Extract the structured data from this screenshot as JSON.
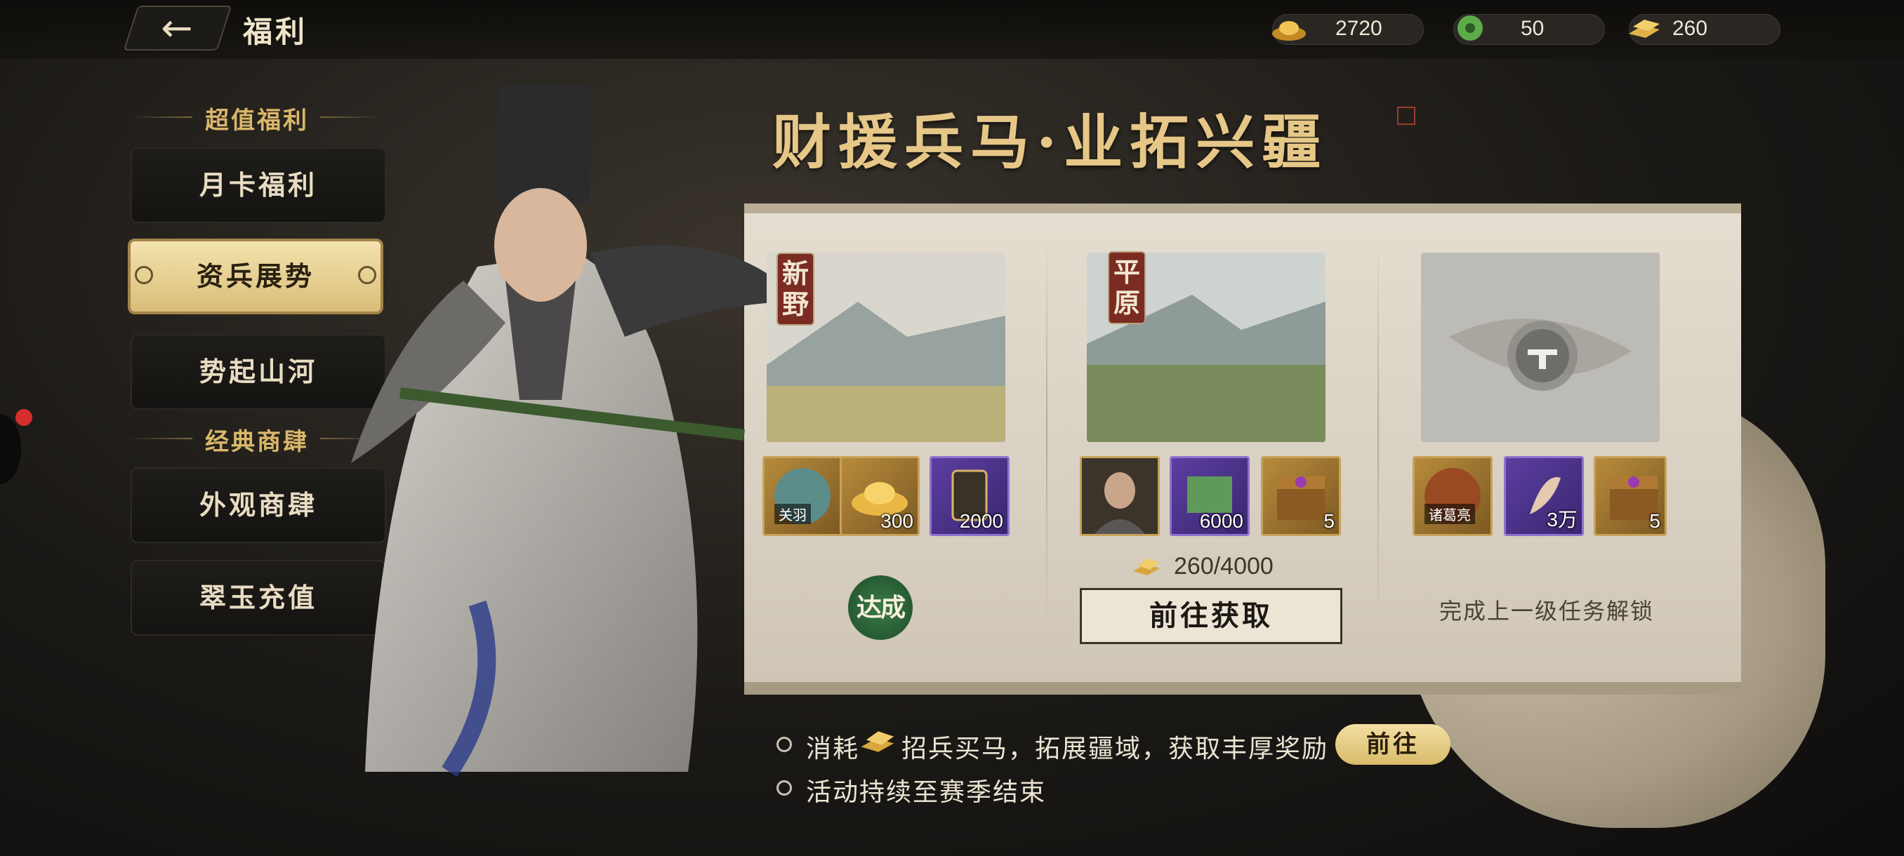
{
  "header": {
    "back_icon": "arrow-left-icon",
    "title": "福利",
    "currencies": [
      {
        "icon": "gold-ingot-icon",
        "value": "2720"
      },
      {
        "icon": "jade-coin-icon",
        "value": "50"
      },
      {
        "icon": "gold-bars-icon",
        "value": "260"
      }
    ]
  },
  "sidebar": {
    "section1_title": "超值福利",
    "section2_title": "经典商肆",
    "items": [
      {
        "label": "月卡福利"
      },
      {
        "label": "资兵展势"
      },
      {
        "label": "势起山河"
      },
      {
        "label": "外观商肆"
      },
      {
        "label": "翠玉充值"
      }
    ]
  },
  "event": {
    "title": "财援兵马·业拓兴疆",
    "stages": [
      {
        "tag": "新野",
        "rewards": [
          {
            "icon": "general-token-guanyu-icon",
            "name": "关羽",
            "count": ""
          },
          {
            "icon": "gold-ingot-icon",
            "count": "300"
          },
          {
            "icon": "purple-token-icon",
            "count": "2000"
          }
        ],
        "status": "达成"
      },
      {
        "tag": "平原",
        "rewards": [
          {
            "icon": "general-portrait-icon",
            "count": ""
          },
          {
            "icon": "green-scroll-icon",
            "count": "6000"
          },
          {
            "icon": "treasure-chest-icon",
            "count": "5"
          }
        ],
        "progress": "260/4000",
        "button": "前往获取"
      },
      {
        "tag": "",
        "lock_icon": "lock-icon",
        "rewards": [
          {
            "icon": "general-token-zhugeliang-icon",
            "name": "诸葛亮",
            "count": ""
          },
          {
            "icon": "purple-feather-icon",
            "count": "3万"
          },
          {
            "icon": "treasure-chest-icon",
            "count": "5"
          }
        ],
        "locked_text": "完成上一级任务解锁"
      }
    ],
    "notes": {
      "line1_prefix": "消耗",
      "line1_suffix": "招兵买马，拓展疆域，获取丰厚奖励",
      "line1_button": "前往",
      "line2": "活动持续至赛季结束"
    }
  }
}
